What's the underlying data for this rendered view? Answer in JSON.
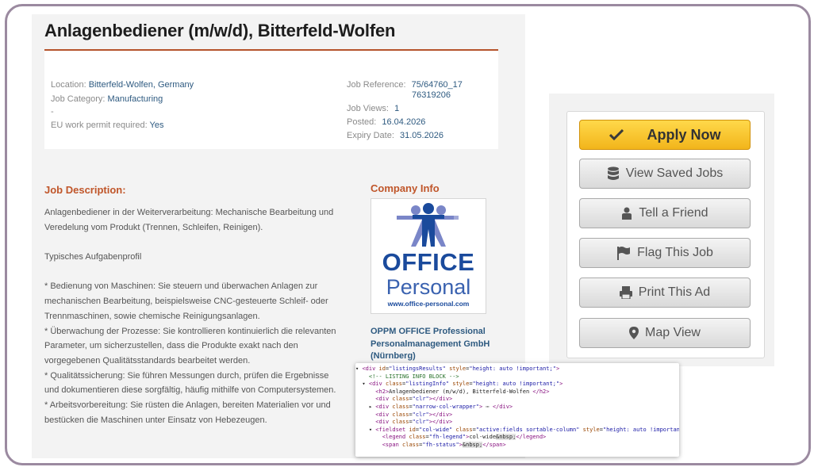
{
  "job": {
    "title": "Anlagenbediener (m/w/d), Bitterfeld-Wolfen",
    "location_label": "Location:",
    "location_value": "Bitterfeld-Wolfen, Germany",
    "category_label": "Job Category:",
    "category_value": "Manufacturing",
    "dash": "-",
    "permit_label": "EU work permit required:",
    "permit_value": "Yes",
    "ref_label": "Job Reference:",
    "ref_value_1": "75/64760_17",
    "ref_value_2": "76319206",
    "views_label": "Job Views:",
    "views_value": "1",
    "posted_label": "Posted:",
    "posted_value": "16.04.2026",
    "expiry_label": "Expiry Date:",
    "expiry_value": "31.05.2026"
  },
  "description": {
    "heading": "Job Description:",
    "intro": "Anlagenbediener in der Weiterverarbeitung: Mechanische Bearbeitung und Veredelung vom Produkt (Trennen, Schleifen, Reinigen).",
    "profile_heading": "Typisches Aufgabenprofil",
    "bullet_1": "* Bedienung von Maschinen: Sie steuern und überwachen Anlagen zur mechanischen Bearbeitung, beispielsweise CNC-gesteuerte Schleif- oder Trennmaschinen, sowie chemische Reinigungsanlagen.",
    "bullet_2": "* Überwachung der Prozesse: Sie kontrollieren kontinuierlich die relevanten Parameter, um sicherzustellen, dass die Produkte exakt nach den vorgegebenen Qualitätsstandards bearbeitet werden.",
    "bullet_3": "* Qualitätssicherung: Sie führen Messungen durch, prüfen die Ergebnisse und dokumentieren diese sorgfältig, häufig mithilfe von Computersystemen.",
    "bullet_4": "* Arbeitsvorbereitung: Sie rüsten die Anlagen, bereiten Materialien vor und bestücken die Maschinen unter Einsatz von Hebezeugen."
  },
  "company": {
    "heading": "Company Info",
    "logo_office": "OFFICE",
    "logo_personal": "Personal",
    "logo_url": "www.office-personal.com",
    "name": "OPPM OFFICE Professional Personalmanagement GmbH (Nürnberg)"
  },
  "actions": {
    "apply": "Apply Now",
    "saved": "View Saved Jobs",
    "friend": "Tell a Friend",
    "flag": "Flag This Job",
    "print": "Print This Ad",
    "map": "Map View"
  },
  "colors": {
    "accent": "#c0562a",
    "link": "#2e5a80",
    "apply_button": "#f2b51b"
  },
  "devtools": {
    "l1_tag": "div",
    "l1_id_attr": "id",
    "l1_id": "\"listingsResults\"",
    "l1_style_attr": "style",
    "l1_style": "\"height: auto !important;\"",
    "l2_comment": "<!-- LISTING INFO BLOCK -->",
    "l3_class": "\"listingInfo\"",
    "l3_style": "\"height: auto !important;\"",
    "l4_text": "Anlagenbediener (m/w/d), Bitterfeld-Wolfen",
    "clr": "\"clr\"",
    "narrow": "\"narrow-col-wrapper\"",
    "fs_id": "\"col-wide\"",
    "fs_class": "\"active:fields sortable-column\"",
    "fs_style": "\"height: auto !important;\"",
    "legend_class": "\"fh-legend\"",
    "legend_text": "col-wide",
    "nbsp": "&nbsp;",
    "span_class": "\"fh-status\""
  }
}
